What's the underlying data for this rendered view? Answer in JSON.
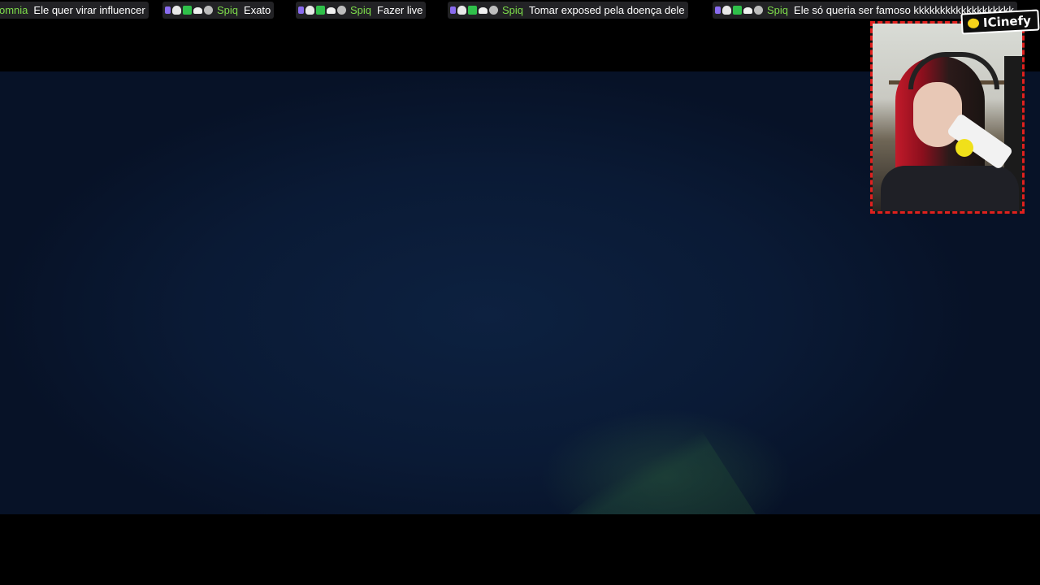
{
  "chat": {
    "messages": [
      {
        "user": "omnia",
        "text": "Ele quer virar influencer",
        "badges": []
      },
      {
        "user": "Spiq",
        "text": "Exato",
        "badges": [
          "purple-badge-icon",
          "skull-badge-icon",
          "check-badge-icon",
          "ghost-badge-icon",
          "moon-badge-icon"
        ]
      },
      {
        "user": "Spiq",
        "text": "Fazer live",
        "badges": [
          "purple-badge-icon",
          "skull-badge-icon",
          "check-badge-icon",
          "ghost-badge-icon",
          "moon-badge-icon"
        ]
      },
      {
        "user": "Spiq",
        "text": "Tomar exposed pela doença dele",
        "badges": [
          "purple-badge-icon",
          "skull-badge-icon",
          "check-badge-icon",
          "ghost-badge-icon",
          "moon-badge-icon"
        ]
      },
      {
        "user": "Spiq",
        "text": "Ele só queria ser famoso kkkkkkkkkkkkkkkkkkk",
        "badges": [
          "purple-badge-icon",
          "skull-badge-icon",
          "check-badge-icon",
          "ghost-badge-icon",
          "moon-badge-icon"
        ]
      }
    ]
  },
  "logo": {
    "text": "ICinefy",
    "icon": "cinefy-logo-icon"
  },
  "colors": {
    "username": "#7ddc4a",
    "webcam_border": "#e0201e",
    "game_background": "#0a1a35",
    "logo_accent": "#f5d21a"
  }
}
